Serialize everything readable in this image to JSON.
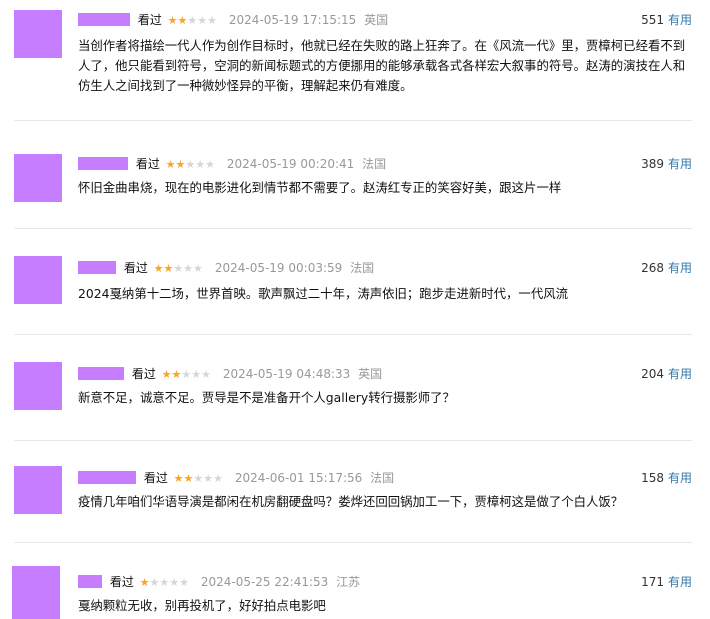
{
  "reviews": [
    {
      "rating_label": "看过",
      "stars": 2,
      "time": "2024-05-19 17:15:15",
      "location": "英国",
      "votes": "551",
      "vote_label": "有用",
      "content": "当创作者将描绘一代人作为创作目标时，他就已经在失败的路上狂奔了。在《风流一代》里，贾樟柯已经看不到人了，他只能看到符号，空洞的新闻标题式的方便挪用的能够承载各式各样宏大叙事的符号。赵涛的演技在人和仿生人之间找到了一种微妙怪异的平衡，理解起来仍有难度。"
    },
    {
      "rating_label": "看过",
      "stars": 2,
      "time": "2024-05-19 00:20:41",
      "location": "法国",
      "votes": "389",
      "vote_label": "有用",
      "content": "怀旧金曲串烧，现在的电影进化到情节都不需要了。赵涛红专正的笑容好美，跟这片一样"
    },
    {
      "rating_label": "看过",
      "stars": 2,
      "time": "2024-05-19 00:03:59",
      "location": "法国",
      "votes": "268",
      "vote_label": "有用",
      "content": "2024戛纳第十二场，世界首映。歌声飘过二十年，涛声依旧；跑步走进新时代，一代风流"
    },
    {
      "rating_label": "看过",
      "stars": 2,
      "time": "2024-05-19 04:48:33",
      "location": "英国",
      "votes": "204",
      "vote_label": "有用",
      "content": "新意不足，诚意不足。贾导是不是准备开个人gallery转行摄影师了？"
    },
    {
      "rating_label": "看过",
      "stars": 2,
      "time": "2024-06-01 15:17:56",
      "location": "法国",
      "votes": "158",
      "vote_label": "有用",
      "content": "疫情几年咱们华语导演是都闲在机房翻硬盘吗？娄烨还回回锅加工一下，贾樟柯这是做了个白人饭？"
    },
    {
      "rating_label": "看过",
      "stars": 1,
      "time": "2024-05-25 22:41:53",
      "location": "江苏",
      "votes": "171",
      "vote_label": "有用",
      "content": "戛纳颗粒无收，别再投机了，好好拍点电影吧"
    }
  ],
  "colors": {
    "avatar": "#c77dff",
    "star_on": "#f5a623",
    "star_off": "#d6d6d6",
    "link": "#3377aa",
    "muted": "#999999"
  }
}
